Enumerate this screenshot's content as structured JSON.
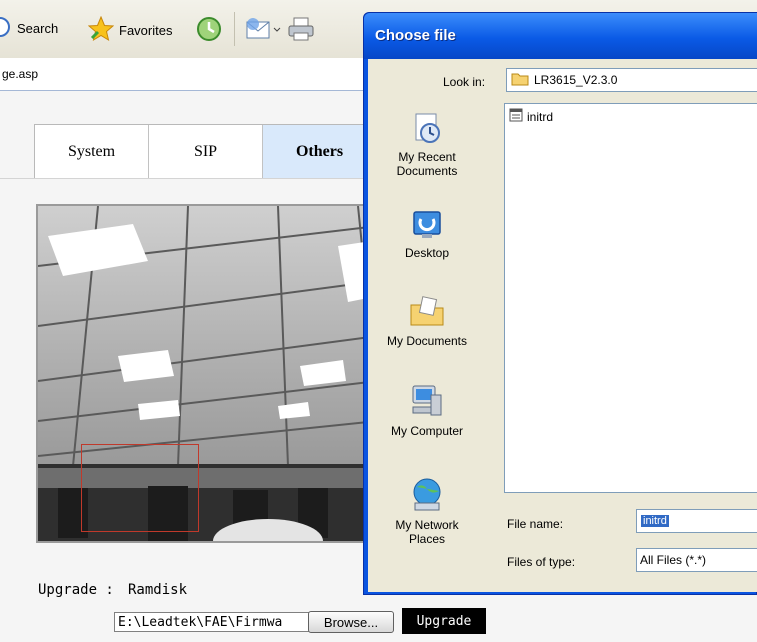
{
  "toolbar": {
    "search_label": "Search",
    "favorites_label": "Favorites"
  },
  "address": {
    "url_fragment": "ge.asp"
  },
  "page": {
    "tabs": [
      {
        "label": "System",
        "active": false
      },
      {
        "label": "SIP",
        "active": false
      },
      {
        "label": "Others",
        "active": true
      }
    ],
    "upgrade_label": "Upgrade :",
    "upgrade_value": "Ramdisk",
    "path_value": "E:\\Leadtek\\FAE\\Firmwa",
    "browse_label": "Browse...",
    "upgrade_button": "Upgrade"
  },
  "dialog": {
    "title": "Choose file",
    "look_in_label": "Look in:",
    "look_in_value": "LR3615_V2.3.0",
    "places": [
      {
        "label": "My Recent Documents",
        "icon": "recent-documents-icon"
      },
      {
        "label": "Desktop",
        "icon": "desktop-icon"
      },
      {
        "label": "My Documents",
        "icon": "my-documents-icon"
      },
      {
        "label": "My Computer",
        "icon": "my-computer-icon"
      },
      {
        "label": "My Network Places",
        "icon": "network-places-icon"
      }
    ],
    "files": [
      {
        "name": "initrd",
        "icon": "file-icon"
      }
    ],
    "file_name_label": "File name:",
    "file_name_value": "initrd",
    "files_of_type_label": "Files of type:",
    "files_of_type_value": "All Files (*.*)"
  },
  "colors": {
    "titlebar": "#0a5ae6",
    "dialog_bg": "#ece9d8",
    "active_tab": "#d9e9fb",
    "motion_box": "#c0392b"
  }
}
